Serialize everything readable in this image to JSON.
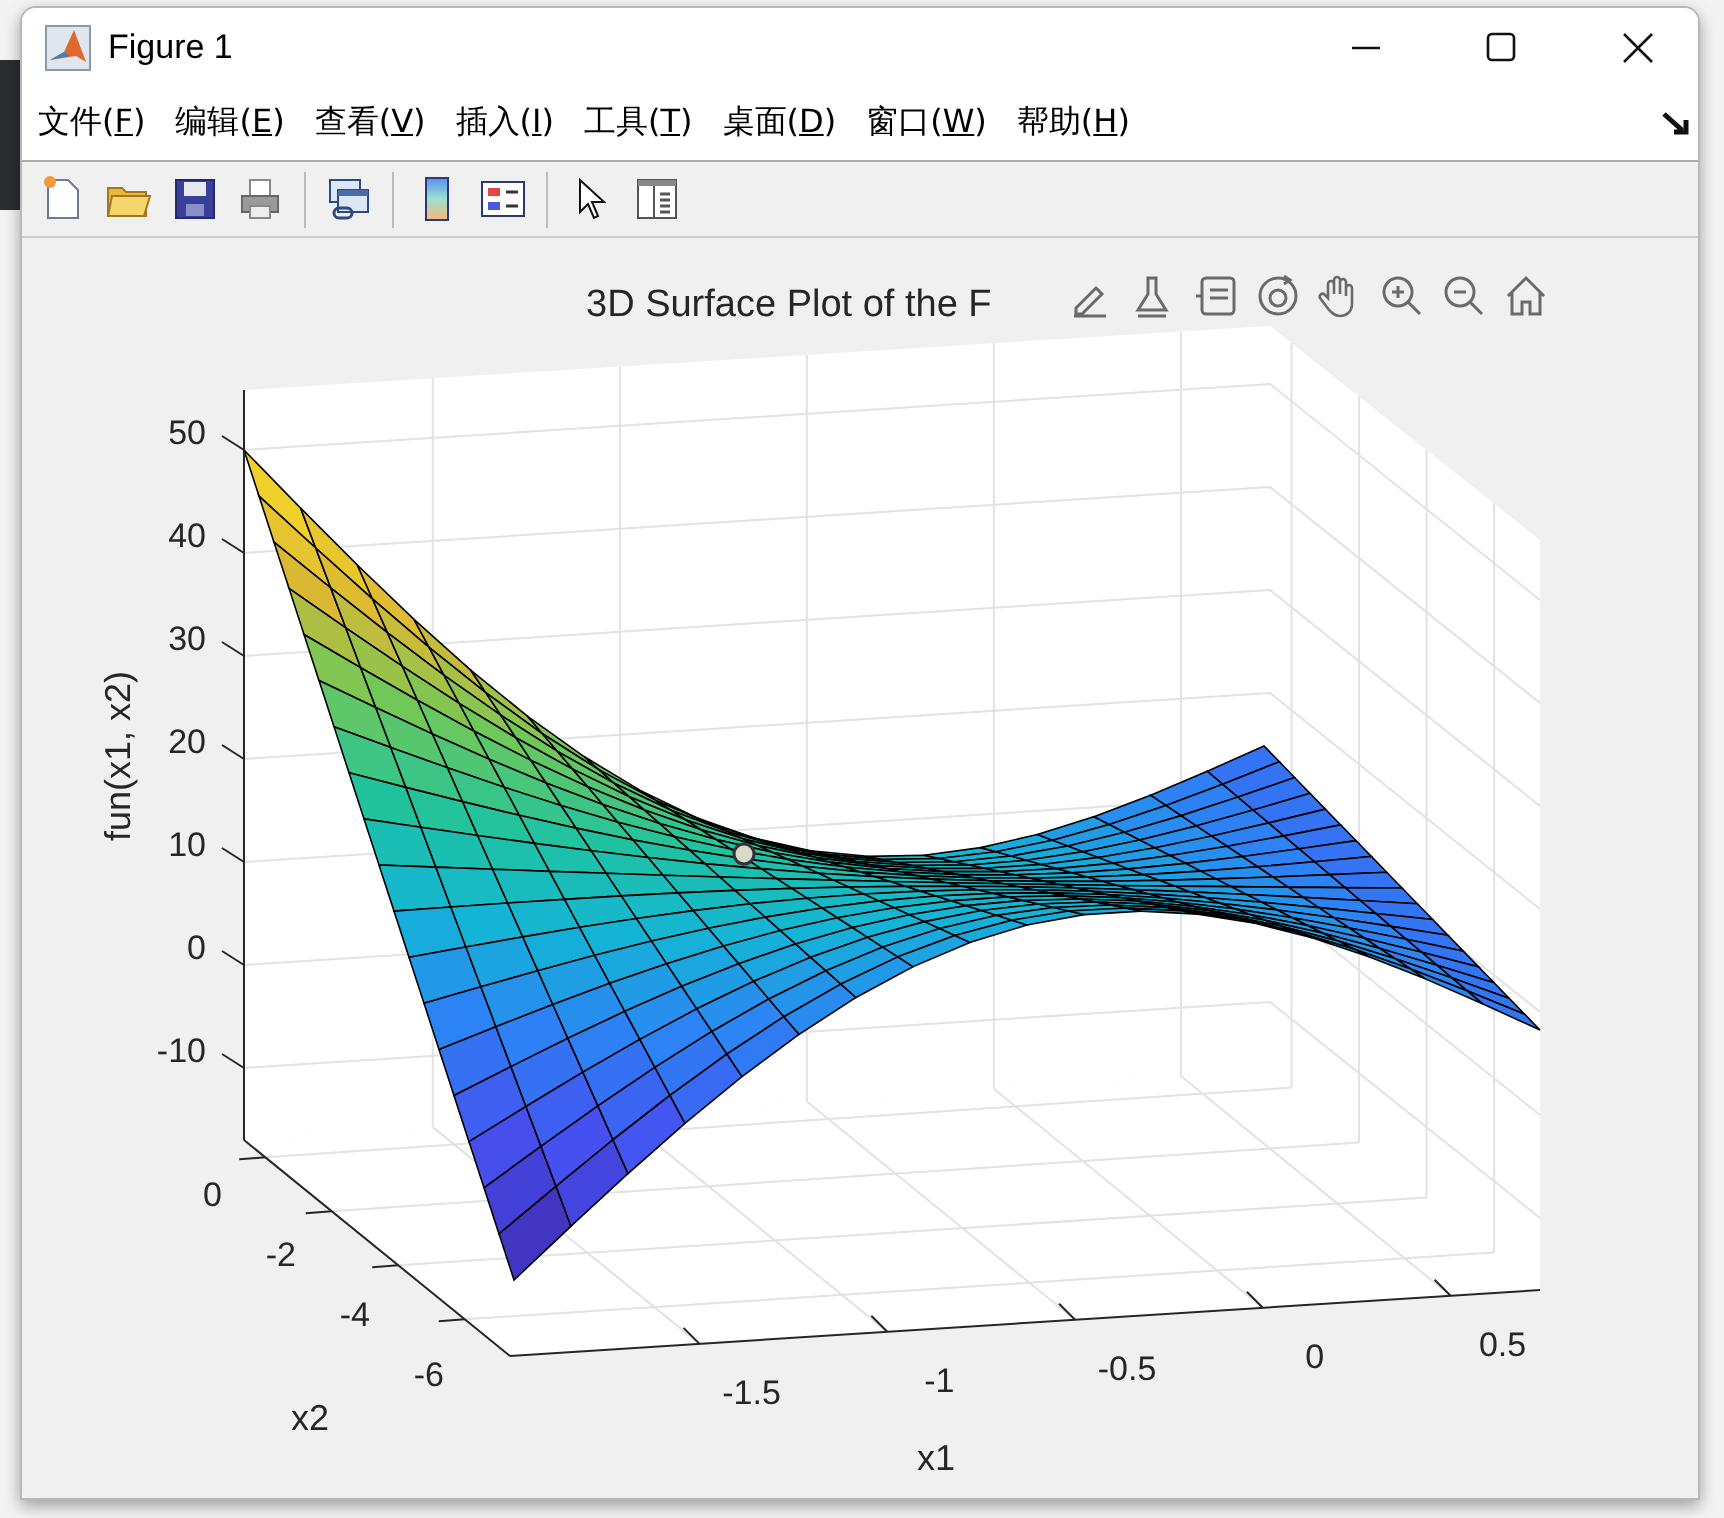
{
  "window": {
    "title": "Figure 1"
  },
  "menu": [
    "文件(F)",
    "编辑(E)",
    "查看(V)",
    "插入(I)",
    "工具(T)",
    "桌面(D)",
    "窗口(W)",
    "帮助(H)"
  ],
  "plot": {
    "title": "3D Surface Plot of the F",
    "xlabel": "x1",
    "ylabel": "x2",
    "zlabel": "fun(x1, x2)",
    "xticks": [
      "-1.5",
      "-1",
      "-0.5",
      "0",
      "0.5"
    ],
    "yticks": [
      "0",
      "-2",
      "-4",
      "-6"
    ],
    "zticks": [
      "50",
      "40",
      "30",
      "20",
      "10",
      "0",
      "-10"
    ]
  }
}
